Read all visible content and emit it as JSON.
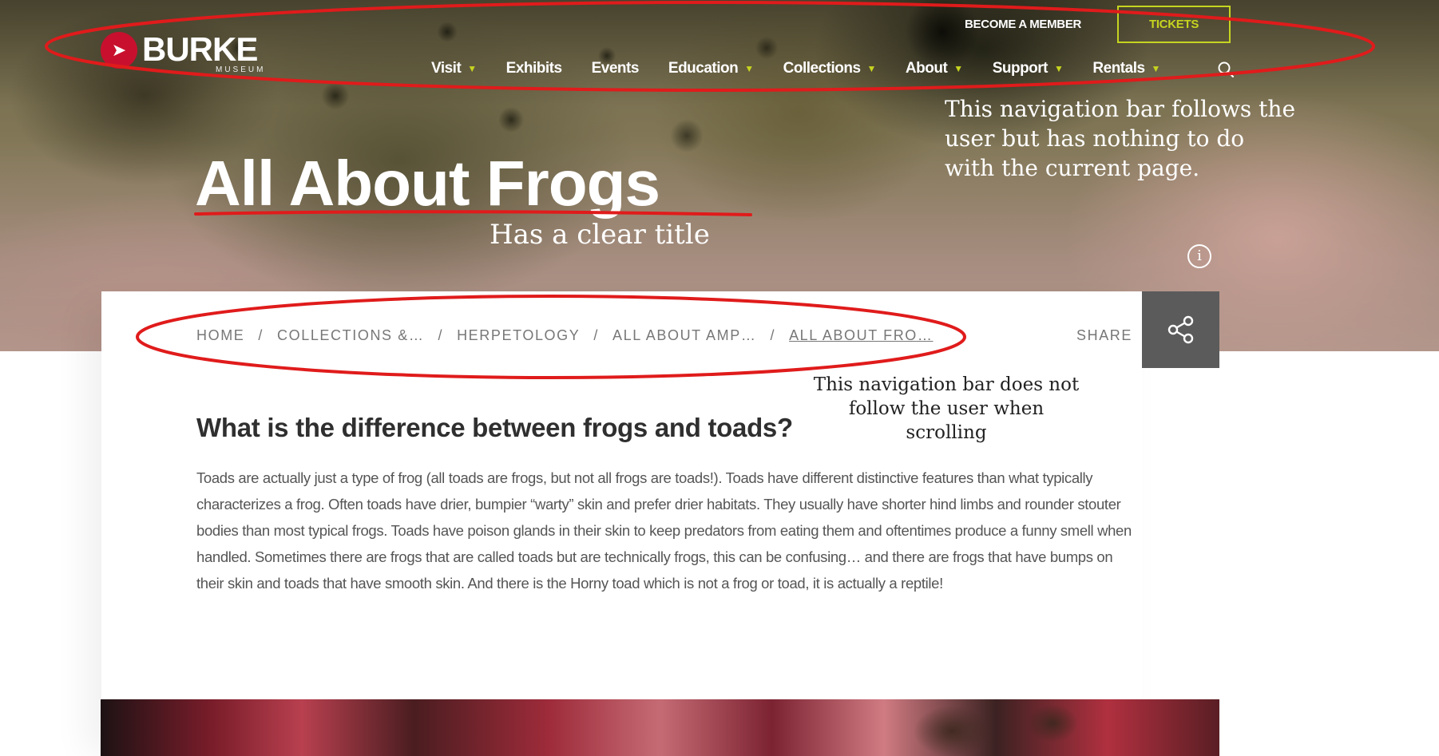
{
  "header": {
    "logo_text": "BURKE",
    "logo_subtitle": "MUSEUM",
    "member_link": "BECOME A MEMBER",
    "tickets_label": "TICKETS",
    "nav": [
      {
        "label": "Visit",
        "has_dropdown": true
      },
      {
        "label": "Exhibits",
        "has_dropdown": false
      },
      {
        "label": "Events",
        "has_dropdown": false
      },
      {
        "label": "Education",
        "has_dropdown": true
      },
      {
        "label": "Collections",
        "has_dropdown": true
      },
      {
        "label": "About",
        "has_dropdown": true
      },
      {
        "label": "Support",
        "has_dropdown": true
      },
      {
        "label": "Rentals",
        "has_dropdown": true
      }
    ]
  },
  "hero": {
    "title": "All About Frogs"
  },
  "breadcrumb": {
    "items": [
      "HOME",
      "COLLECTIONS &…",
      "HERPETOLOGY",
      "ALL ABOUT AMP…"
    ],
    "current": "ALL ABOUT FRO…",
    "separator": "/"
  },
  "share": {
    "label": "SHARE"
  },
  "article": {
    "heading": "What is the difference between frogs and toads?",
    "body": "Toads are actually just a type of frog (all toads are frogs, but not all frogs are toads!). Toads have different distinctive features than what typically characterizes a frog. Often toads have drier, bumpier “warty” skin and prefer drier habitats. They usually have shorter hind limbs and rounder stouter bodies than most typical frogs. Toads have poison glands in their skin to keep predators from eating them and oftentimes produce a funny smell when handled. Sometimes there are frogs that are called toads but are technically frogs, this can be confusing… and there are frogs that have bumps on their skin and toads that have smooth skin. And there is the Horny toad which is not a frog or toad, it is actually a reptile!"
  },
  "annotations": {
    "nav_note": "This navigation bar follows the user but has nothing to do with the current page.",
    "title_note": "Has a clear title",
    "breadcrumb_note": "This navigation bar does not follow the user when scrolling"
  },
  "colors": {
    "accent_lime": "#c6d41f",
    "brand_red": "#c8102e",
    "annotation_red": "#e01b1b",
    "share_bg": "#5b5b5b"
  },
  "icons": [
    "burke-logo-icon",
    "chevron-down-icon",
    "search-icon",
    "info-icon",
    "share-icon"
  ]
}
